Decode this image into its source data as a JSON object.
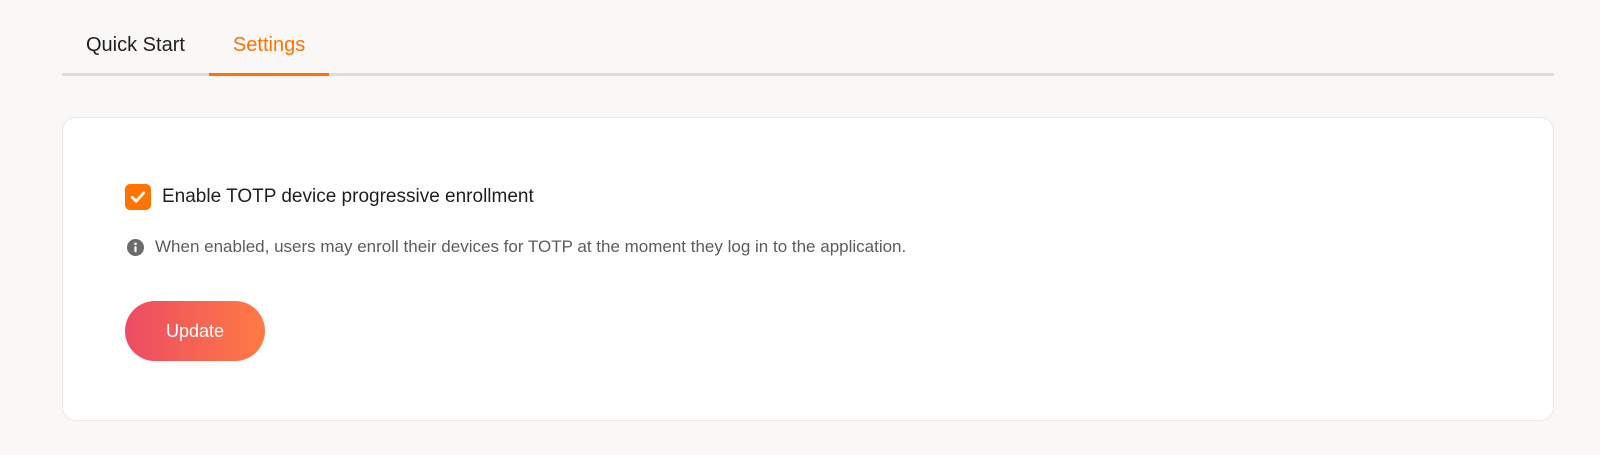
{
  "tabs": [
    {
      "label": "Quick Start",
      "active": false
    },
    {
      "label": "Settings",
      "active": true
    }
  ],
  "settings": {
    "checkbox_label": "Enable TOTP device progressive enrollment",
    "checkbox_checked": true,
    "hint": "When enabled, users may enroll their devices for TOTP at the moment they log in to the application.",
    "update_label": "Update"
  },
  "icons": {
    "checkbox": "checkmark-icon",
    "hint": "info-icon"
  },
  "colors": {
    "accent": "#ff7300",
    "button_gradient_start": "#ec4b64",
    "button_gradient_end": "#fe7b43",
    "background": "#f9f8f7",
    "card": "#ffffff"
  }
}
